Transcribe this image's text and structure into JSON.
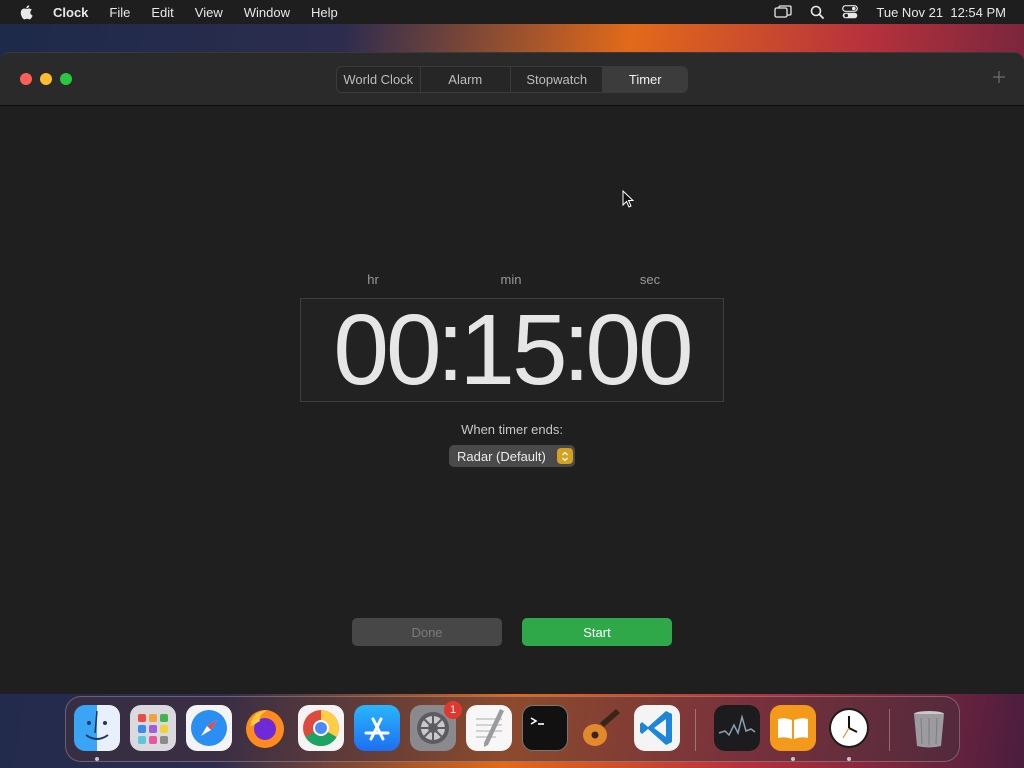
{
  "menubar": {
    "app_name": "Clock",
    "items": [
      "File",
      "Edit",
      "View",
      "Window",
      "Help"
    ],
    "datetime": "Tue Nov 21  12:54 PM"
  },
  "window": {
    "tabs": [
      {
        "label": "World Clock",
        "active": false
      },
      {
        "label": "Alarm",
        "active": false
      },
      {
        "label": "Stopwatch",
        "active": false
      },
      {
        "label": "Timer",
        "active": true
      }
    ]
  },
  "timer": {
    "hr_label": "hr",
    "min_label": "min",
    "sec_label": "sec",
    "hours": "00",
    "minutes": "15",
    "seconds": "00",
    "ends_label": "When timer ends:",
    "sound_selected": "Radar (Default)",
    "done_label": "Done",
    "start_label": "Start"
  },
  "dock": {
    "apps": [
      "Finder",
      "Launchpad",
      "Safari",
      "Firefox",
      "Chrome",
      "App Store",
      "System Settings",
      "TextEdit",
      "Terminal",
      "GarageBand",
      "Visual Studio Code",
      "Stocks",
      "Books",
      "Clock",
      "Trash"
    ],
    "system_settings_badge": "1"
  },
  "colors": {
    "start_button": "#2fa84a",
    "select_stepper": "#d6a020",
    "window_bg": "#1f1f1f"
  }
}
